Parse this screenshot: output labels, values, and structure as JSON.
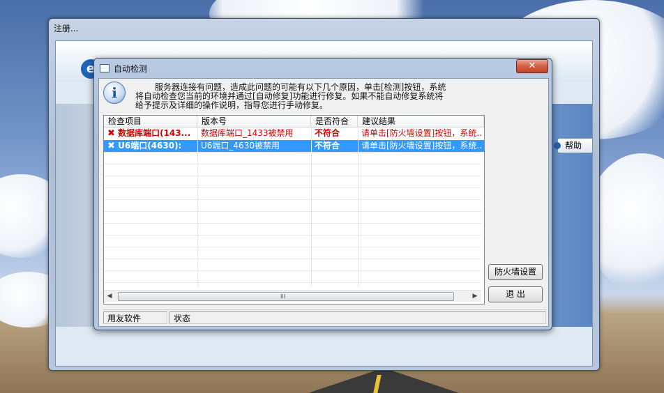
{
  "outer_window": {
    "title": "注册...",
    "logo_glyph": "e",
    "help_label": "帮助"
  },
  "dialog": {
    "title": "自动检测",
    "close_glyph": "✕",
    "message_line1": "服务器连接有问题，造成此问题的可能有以下几个原因，单击[检测]按钮，系统",
    "message_line2": "将自动检查您当前的环境并通过[自动修复]功能进行修复。如果不能自动修复系统将",
    "message_line3": "给予提示及详细的操作说明，指导您进行手动修复。",
    "info_glyph": "i"
  },
  "list": {
    "columns": [
      "检查项目",
      "版本号",
      "是否符合",
      "建议结果"
    ],
    "rows": [
      {
        "status_icon": "✖",
        "item": "数据库端口(143...",
        "version": "数据库端口_1433被禁用",
        "match": "不符合",
        "advice": "请单击[防火墙设置]按钮，系统...",
        "selected": false
      },
      {
        "status_icon": "✖",
        "item": "U6端口(4630):",
        "version": "U6端口_4630被禁用",
        "match": "不符合",
        "advice": "请单击[防火墙设置]按钮，系统...",
        "selected": true
      }
    ],
    "scroll_left": "◀",
    "scroll_right": "▶",
    "scroll_grip": "III"
  },
  "buttons": {
    "firewall": "防火墙设置",
    "exit": "退  出"
  },
  "statusbar": {
    "company": "用友软件",
    "status": "状态"
  },
  "colors": {
    "selection": "#3399ff",
    "error_text": "#d40000",
    "close_button": "#c0452c"
  }
}
